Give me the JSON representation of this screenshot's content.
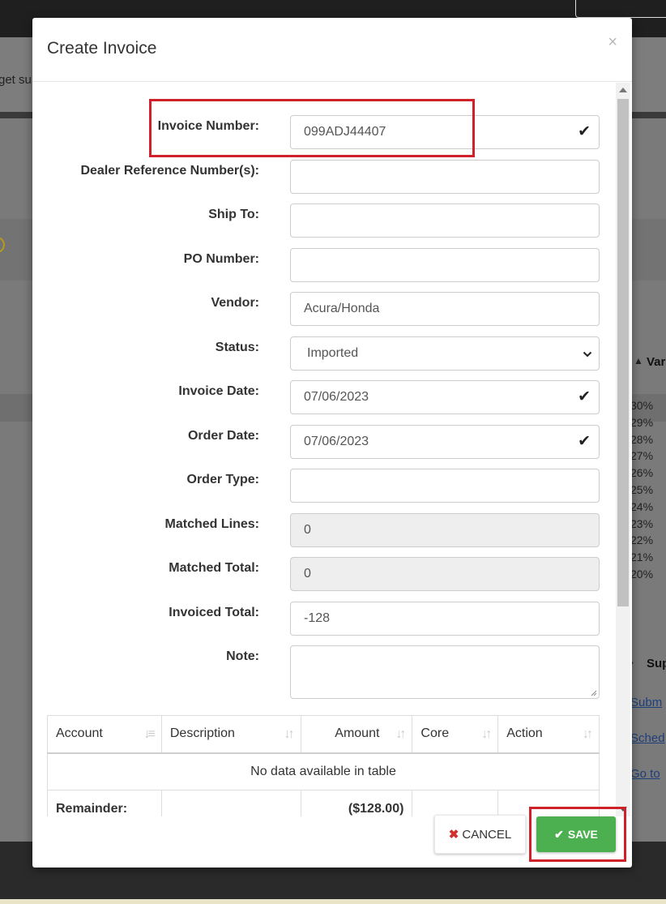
{
  "modal": {
    "title": "Create Invoice",
    "close_icon": "×"
  },
  "form": {
    "invoice_number": {
      "label": "Invoice Number:",
      "value": "099ADJ44407",
      "valid": true
    },
    "dealer_reference": {
      "label": "Dealer Reference Number(s):",
      "value": ""
    },
    "ship_to": {
      "label": "Ship To:",
      "value": ""
    },
    "po_number": {
      "label": "PO Number:",
      "value": ""
    },
    "vendor": {
      "label": "Vendor:",
      "value": "Acura/Honda"
    },
    "status": {
      "label": "Status:",
      "value": "Imported",
      "options": [
        "Imported"
      ]
    },
    "invoice_date": {
      "label": "Invoice Date:",
      "value": "07/06/2023",
      "valid": true
    },
    "order_date": {
      "label": "Order Date:",
      "value": "07/06/2023",
      "valid": true
    },
    "order_type": {
      "label": "Order Type:",
      "value": ""
    },
    "matched_lines": {
      "label": "Matched Lines:",
      "value": "0"
    },
    "matched_total": {
      "label": "Matched Total:",
      "value": "0"
    },
    "invoiced_total": {
      "label": "Invoiced Total:",
      "value": "-128"
    },
    "note": {
      "label": "Note:",
      "value": ""
    }
  },
  "table": {
    "columns": [
      "Account",
      "Description",
      "Amount",
      "Core",
      "Action"
    ],
    "empty_message": "No data available in table",
    "remainder_label": "Remainder:",
    "remainder_amount": "($128.00)"
  },
  "footer": {
    "cancel_label": "CANCEL",
    "save_label": "SAVE"
  },
  "background": {
    "left_text": "get su",
    "right_title": "Var",
    "right_section": "Sup",
    "links": [
      "Subm",
      "Sched",
      "Go to"
    ],
    "axis_ticks": [
      "30%",
      "29%",
      "28%",
      "27%",
      "26%",
      "25%",
      "24%",
      "23%",
      "22%",
      "21%",
      "20%"
    ]
  },
  "colors": {
    "save_green": "#4caf50",
    "highlight_red": "#d0202a",
    "cancel_x_red": "#d32f2f"
  }
}
